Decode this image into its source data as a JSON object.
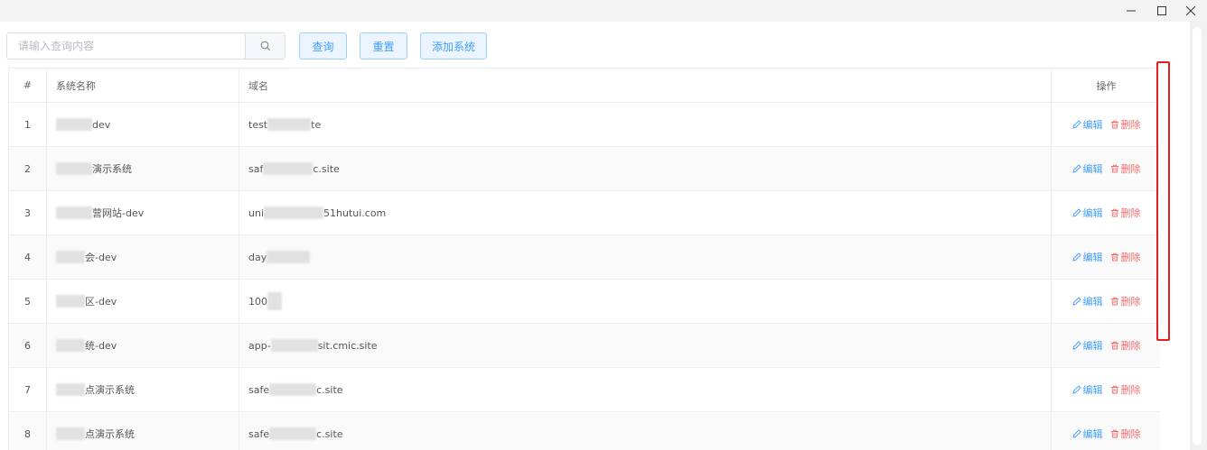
{
  "toolbar": {
    "search_placeholder": "请输入查询内容",
    "query_label": "查询",
    "reset_label": "重置",
    "add_label": "添加系统"
  },
  "table": {
    "headers": {
      "index": "#",
      "name": "系统名称",
      "domain": "域名",
      "operations": "操作"
    },
    "edit_label": "编辑",
    "delete_label": "删除",
    "rows": [
      {
        "index": "1",
        "name": "dev",
        "domain_prefix": "test",
        "domain_suffix": "te"
      },
      {
        "index": "2",
        "name": "演示系统",
        "domain_prefix": "saf",
        "domain_suffix": "c.site"
      },
      {
        "index": "3",
        "name": "营网站-dev",
        "domain_prefix": "uni",
        "domain_suffix": "51hutui.com"
      },
      {
        "index": "4",
        "name": "会-dev",
        "domain_prefix": "day",
        "domain_suffix": ""
      },
      {
        "index": "5",
        "name": "区-dev",
        "domain_prefix": "100",
        "domain_suffix": ""
      },
      {
        "index": "6",
        "name": "统-dev",
        "domain_prefix": "app-",
        "domain_suffix": "sit.cmic.site"
      },
      {
        "index": "7",
        "name": "点演示系统",
        "domain_prefix": "safe",
        "domain_suffix": "c.site"
      },
      {
        "index": "8",
        "name": "点演示系统",
        "domain_prefix": "safe",
        "domain_suffix": "c.site"
      }
    ]
  },
  "colors": {
    "primary": "#409eff",
    "danger": "#f56c6c",
    "highlight": "#e02020"
  }
}
